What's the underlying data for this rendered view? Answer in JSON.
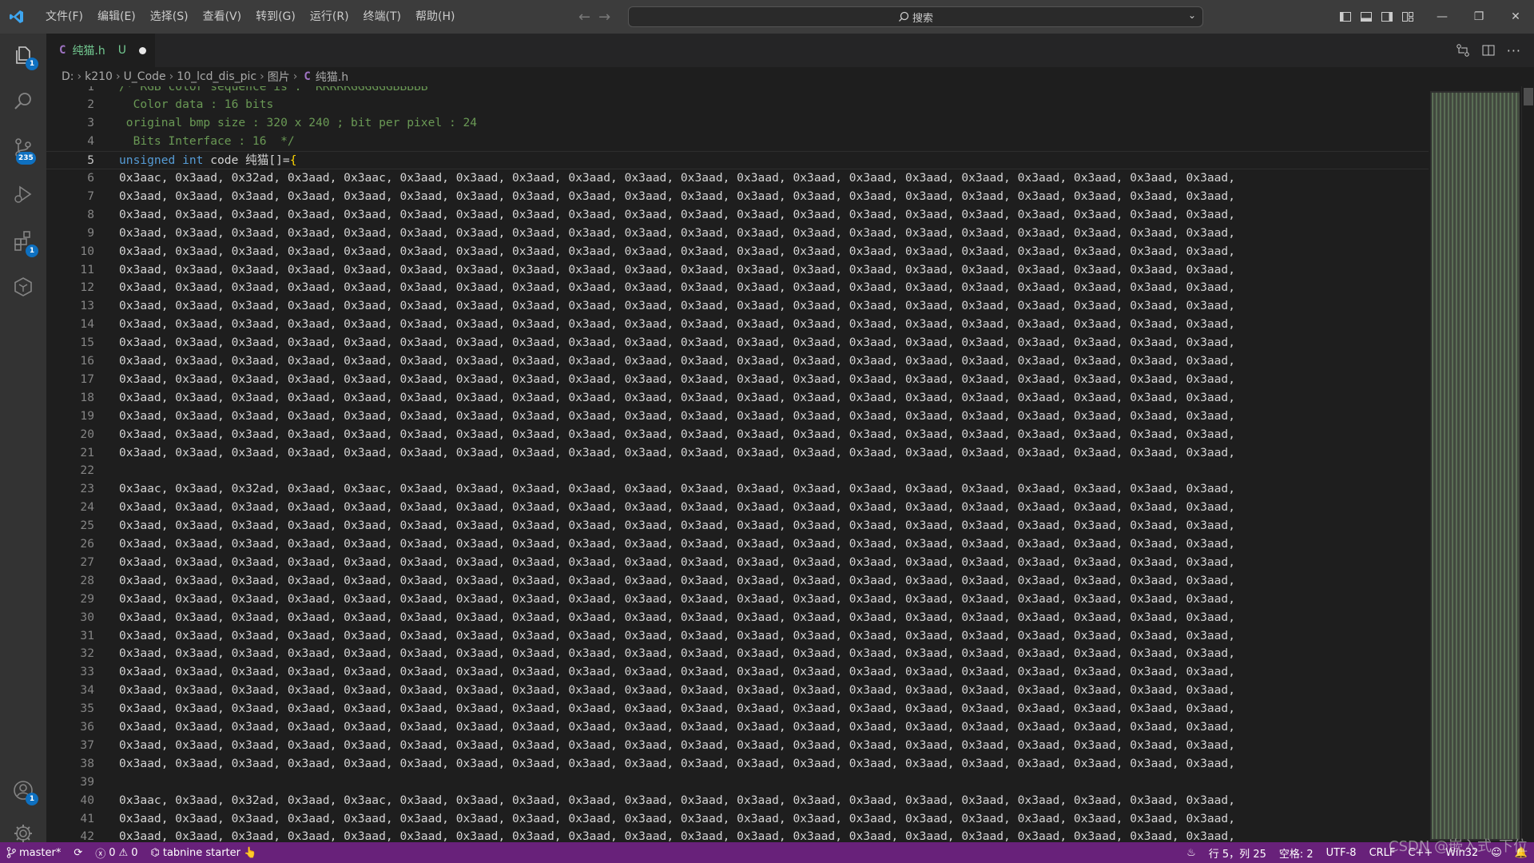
{
  "title_bar": {
    "menu": [
      "文件(F)",
      "编辑(E)",
      "选择(S)",
      "查看(V)",
      "转到(G)",
      "运行(R)",
      "终端(T)",
      "帮助(H)"
    ],
    "search_placeholder": "搜索"
  },
  "activity_bar": {
    "explorer_badge": "1",
    "source_control_badge": "235",
    "extensions_badge": "1",
    "accounts_badge": "1"
  },
  "tab": {
    "lang_glyph": "C",
    "title": "纯猫.h",
    "status": "U"
  },
  "breadcrumb": {
    "items": [
      "D:",
      "k210",
      "U_Code",
      "10_lcd_dis_pic",
      "图片"
    ],
    "file_glyph": "C",
    "file": "纯猫.h"
  },
  "editor": {
    "header_lines": [
      "/* RGB color sequence is :  RRRRRGGGGGGBBBBB",
      "  Color data : 16 bits",
      " original bmp size : 320 x 240 ; bit per pixel : 24",
      "  Bits Interface : 16  */"
    ],
    "decl_keyword": "unsigned int",
    "decl_name": " code 纯猫",
    "decl_punct": "[]=",
    "decl_brace": "{",
    "first_row": "0x3aac, 0x3aad, 0x32ad, 0x3aad, 0x3aac, 0x3aad, 0x3aad, 0x3aad, 0x3aad, 0x3aad, 0x3aad, 0x3aad, 0x3aad, 0x3aad, 0x3aad, 0x3aad, 0x3aad, 0x3aad, 0x3aad, 0x3aad,",
    "block_first_row": "0x3aac, 0x3aad, 0x32ad, 0x3aad, 0x3aac, 0x3aad, 0x3aad, 0x3aad, 0x3aad, 0x3aad, 0x3aad, 0x3aad, 0x3aad, 0x3aad, 0x3aad, 0x3aad, 0x3aad, 0x3aad, 0x3aad, 0x3aad,",
    "fill_row": "0x3aad, 0x3aad, 0x3aad, 0x3aad, 0x3aad, 0x3aad, 0x3aad, 0x3aad, 0x3aad, 0x3aad, 0x3aad, 0x3aad, 0x3aad, 0x3aad, 0x3aad, 0x3aad, 0x3aad, 0x3aad, 0x3aad, 0x3aad,",
    "current_line": 5,
    "last_visible_line": 42
  },
  "status_bar": {
    "branch": "master*",
    "errors": "0",
    "warnings": "0",
    "tabnine": "tabnine starter",
    "position": "行 5，列 25",
    "indent": "空格: 2",
    "encoding": "UTF-8",
    "eol": "CRLF",
    "language": "C++",
    "config": "Win32"
  },
  "watermark": "CSDN @嵌入式_下位"
}
